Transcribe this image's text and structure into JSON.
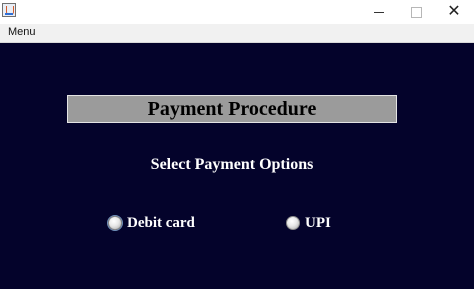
{
  "window": {
    "close_glyph": "✕"
  },
  "menu": {
    "items": [
      "Menu"
    ]
  },
  "form": {
    "heading": "Payment Procedure",
    "subheading": "Select Payment Options",
    "options": [
      {
        "label": "Debit card"
      },
      {
        "label": "UPI"
      }
    ]
  },
  "colors": {
    "background": "#04032b",
    "heading_box": "#9b9b9b",
    "text": "#ffffff"
  }
}
